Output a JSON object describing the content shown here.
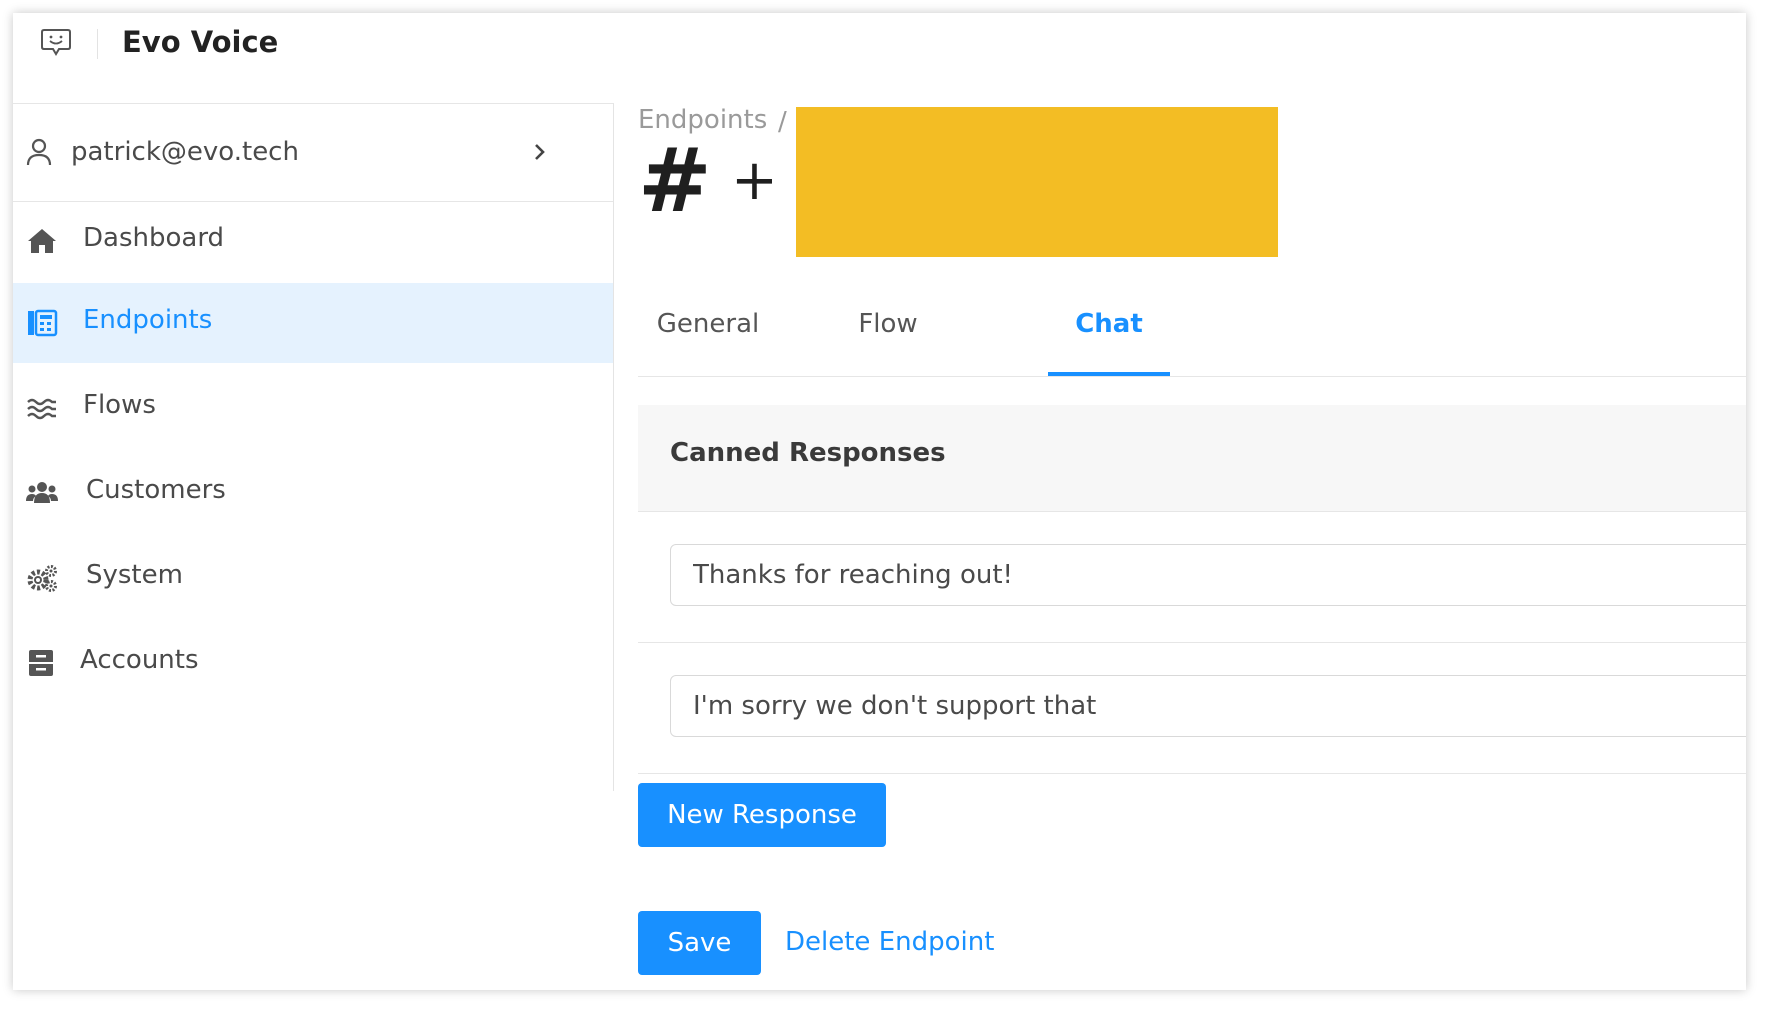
{
  "app": {
    "title": "Evo Voice"
  },
  "user": {
    "email": "patrick@evo.tech"
  },
  "sidebar": {
    "items": [
      {
        "label": "Dashboard",
        "icon": "home-icon",
        "active": false
      },
      {
        "label": "Endpoints",
        "icon": "endpoints-icon",
        "active": true
      },
      {
        "label": "Flows",
        "icon": "flows-icon",
        "active": false
      },
      {
        "label": "Customers",
        "icon": "customers-icon",
        "active": false
      },
      {
        "label": "System",
        "icon": "gears-icon",
        "active": false
      },
      {
        "label": "Accounts",
        "icon": "accounts-icon",
        "active": false
      }
    ]
  },
  "breadcrumb": {
    "root": "Endpoints",
    "separator": "/"
  },
  "page": {
    "title_prefix": "#",
    "title_plus": "+"
  },
  "tabs": [
    {
      "label": "General",
      "active": false
    },
    {
      "label": "Flow",
      "active": false
    },
    {
      "label": "Chat",
      "active": true
    }
  ],
  "canned": {
    "title": "Canned Responses",
    "responses": [
      "Thanks for reaching out!",
      "I'm sorry we don't support that"
    ],
    "new_button": "New Response"
  },
  "actions": {
    "save": "Save",
    "delete": "Delete Endpoint"
  },
  "colors": {
    "accent": "#1890ff",
    "active_bg": "#e5f2fe",
    "redaction": "#f3bd24"
  }
}
